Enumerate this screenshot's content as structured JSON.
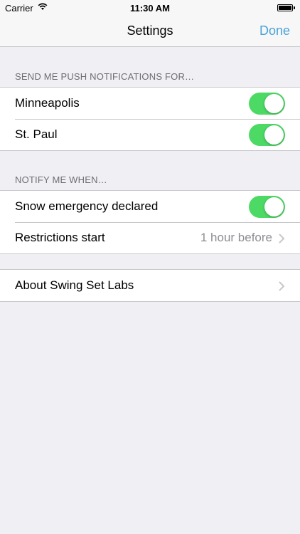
{
  "status_bar": {
    "carrier": "Carrier",
    "time": "11:30 AM",
    "battery_level": 1.0
  },
  "nav_bar": {
    "title": "Settings",
    "done_label": "Done",
    "accent_color": "#4aa3d8"
  },
  "sections": {
    "push": {
      "header": "SEND ME PUSH NOTIFICATIONS FOR…",
      "items": [
        {
          "label": "Minneapolis",
          "toggle": true
        },
        {
          "label": "St. Paul",
          "toggle": true
        }
      ]
    },
    "notify": {
      "header": "NOTIFY ME WHEN…",
      "items": [
        {
          "label": "Snow emergency declared",
          "toggle": true
        },
        {
          "label": "Restrictions start",
          "detail": "1 hour before"
        }
      ]
    },
    "about": {
      "items": [
        {
          "label": "About Swing Set Labs"
        }
      ]
    }
  },
  "colors": {
    "toggle_on": "#4cd964",
    "background": "#efeff4"
  }
}
